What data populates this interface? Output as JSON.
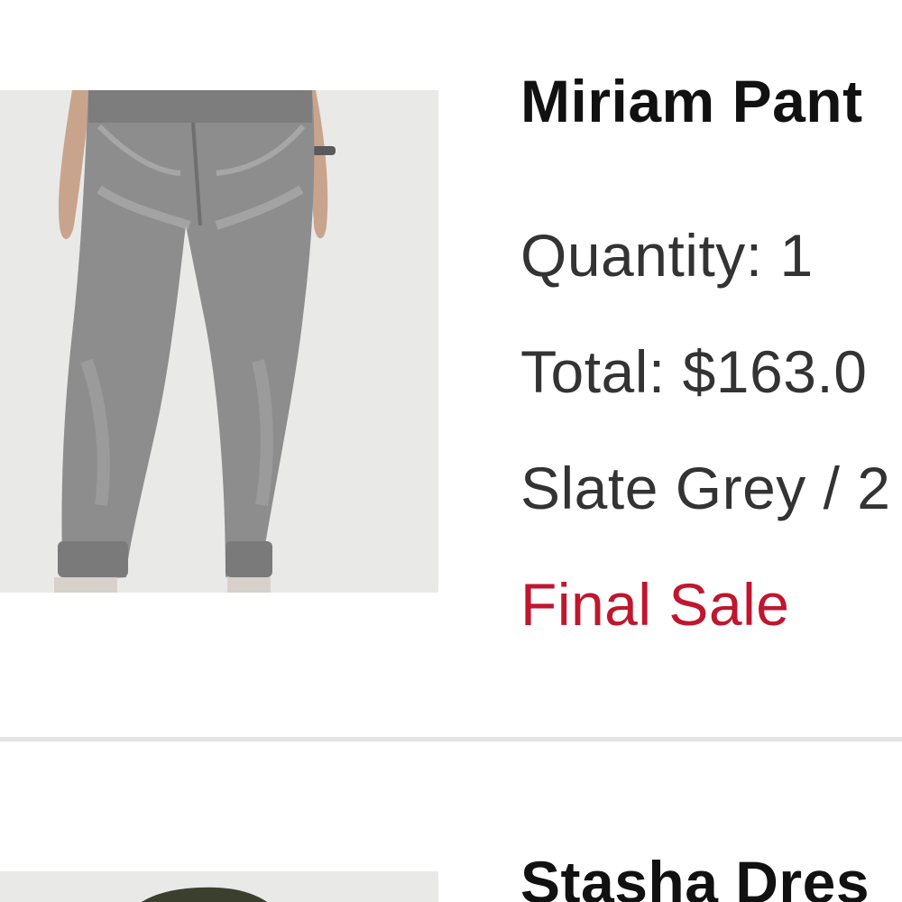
{
  "items": [
    {
      "title": "Miriam Pant",
      "quantity": "Quantity: 1",
      "total": "Total: $163.0",
      "variant": "Slate Grey / 2",
      "sale_label": "Final Sale"
    },
    {
      "title": "Stasha Dres"
    }
  ],
  "colors": {
    "title": "#111111",
    "detail": "#333333",
    "sale": "#c0162e",
    "divider": "#e4e4e4",
    "thumb_bg": "#e9e9e8",
    "denim": "#8d8d8d"
  },
  "icons": {
    "item_1_image": "grey-jogger-jeans-photo",
    "item_2_image": "olive-dress-photo"
  }
}
